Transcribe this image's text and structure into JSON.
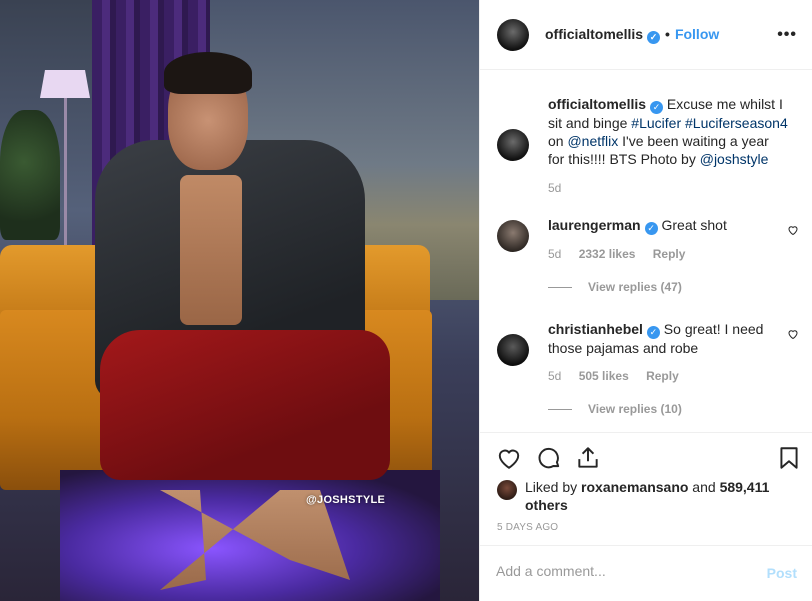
{
  "photo": {
    "watermark": "@JOSHSTYLE"
  },
  "header": {
    "username": "officialtomellis",
    "separator": "•",
    "follow_label": "Follow",
    "more_icon": "more-options-icon"
  },
  "caption": {
    "username": "officialtomellis",
    "text_1": " Excuse me whilst I sit and binge ",
    "tag_1": "#Lucifer",
    "text_2": " ",
    "tag_2": "#Luciferseason4",
    "text_3": " on ",
    "mention_1": "@netflix",
    "text_4": " I've been waiting a year for this!!!! BTS Photo by ",
    "mention_2": "@joshstyle",
    "time": "5d"
  },
  "comments": [
    {
      "username": "laurengerman",
      "text": " Great shot",
      "time": "5d",
      "likes": "2332 likes",
      "reply_label": "Reply",
      "view_replies": "View replies (47)"
    },
    {
      "username": "christianhebel",
      "text": " So great! I need those pajamas and robe",
      "time": "5d",
      "likes": "505 likes",
      "reply_label": "Reply",
      "view_replies": "View replies (10)"
    }
  ],
  "likes": {
    "prefix": "Liked by ",
    "user": "roxanemansano",
    "middle": " and ",
    "count": "589,411 others"
  },
  "post_date": "5 DAYS AGO",
  "add_comment": {
    "placeholder": "Add a comment...",
    "post_label": "Post"
  },
  "colors": {
    "link": "#003569",
    "accent": "#3897f0",
    "muted": "#999999",
    "post_disabled": "#b2dffc"
  }
}
